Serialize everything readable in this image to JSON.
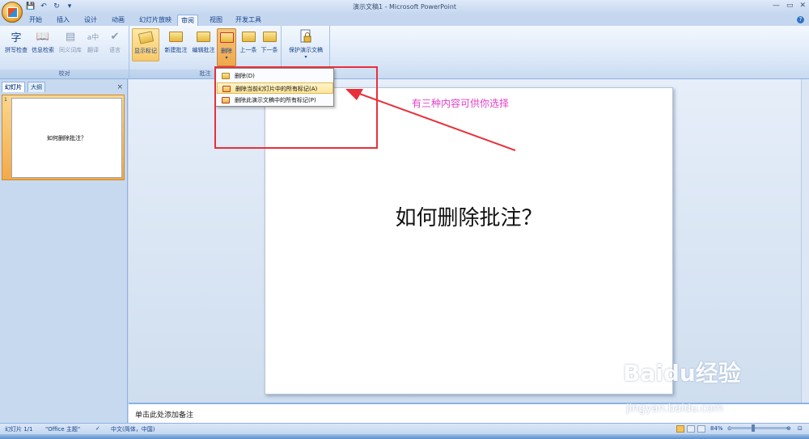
{
  "window": {
    "title": "演示文稿1 - Microsoft PowerPoint",
    "controls": [
      "—",
      "▭",
      "✕"
    ]
  },
  "qat": {
    "icons": [
      "save-icon",
      "undo-icon",
      "redo-icon",
      "customize-icon"
    ],
    "glyphs": [
      "💾",
      "↶",
      "↻",
      "▾"
    ]
  },
  "tabs": [
    {
      "label": "开始"
    },
    {
      "label": "插入"
    },
    {
      "label": "设计"
    },
    {
      "label": "动画"
    },
    {
      "label": "幻灯片放映"
    },
    {
      "label": "审阅",
      "active": true
    },
    {
      "label": "视图"
    },
    {
      "label": "开发工具"
    }
  ],
  "ribbon": {
    "groups": [
      {
        "label": "校对",
        "buttons": [
          "拼写检查",
          "信息检索",
          "同义词库",
          "翻译",
          "语言"
        ]
      },
      {
        "label": "批注",
        "buttons": [
          "显示标记",
          "新建批注",
          "编辑批注",
          "删除",
          "上一条",
          "下一条"
        ]
      },
      {
        "label": "",
        "buttons": [
          "保护演示文稿"
        ]
      }
    ],
    "proof_glyphs": [
      "字",
      "📖",
      "▤",
      "a中",
      "✔"
    ]
  },
  "delete_menu": {
    "items": [
      {
        "label": "删除(D)"
      },
      {
        "label": "删除当前幻灯片中的所有标记(A)"
      },
      {
        "label": "删除此演示文稿中的所有标记(P)"
      }
    ]
  },
  "sidebar": {
    "tabs": [
      "幻灯片",
      "大纲"
    ],
    "close": "×",
    "slide_number": "1",
    "thumb_title": "如何删除批注？"
  },
  "slide": {
    "title": "如何删除批注？"
  },
  "notes": {
    "placeholder": "单击此处添加备注"
  },
  "status": {
    "slide_info": "幻灯片 1/1",
    "theme": "\"Office 主题\"",
    "language": "中文(简体，中国)",
    "zoom": "84%",
    "zoom_level": 0.84
  },
  "annotation": {
    "text": "有三种内容可供你选择"
  },
  "watermark": {
    "brand": "Baidu经验",
    "url": "jingyan.baidu.com"
  },
  "colors": {
    "accent_red": "#e8303a",
    "annotation_pink": "#e43fc9",
    "ribbon_blue": "#15428b"
  }
}
